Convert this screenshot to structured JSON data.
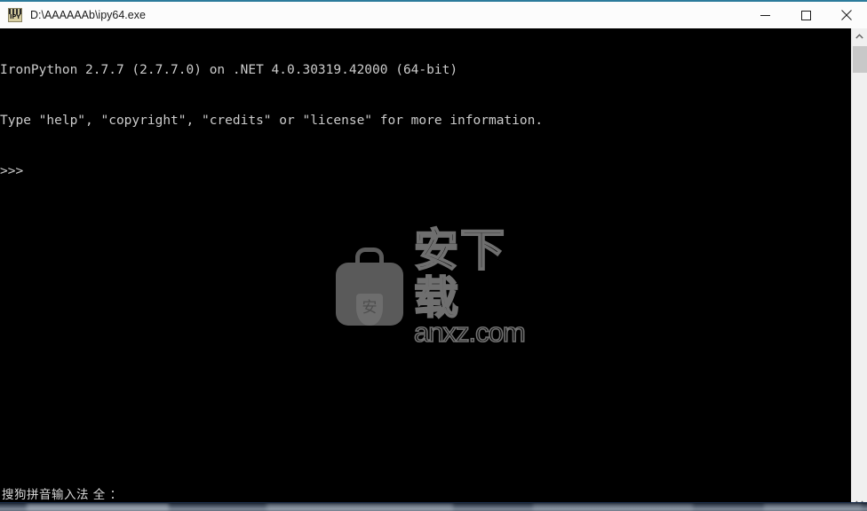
{
  "window": {
    "title": "D:\\AAAAAAb\\ipy64.exe",
    "icon_label": "IPY",
    "icon_name": "ironpython-console-icon",
    "accent_color": "#2c7b9c",
    "titlebar_bg": "#fcfcfc",
    "controls": {
      "minimize_label": "Minimize",
      "maximize_label": "Maximize",
      "close_label": "Close"
    }
  },
  "console": {
    "background_color": "#000000",
    "text_color": "#cccccc",
    "lines": [
      "IronPython 2.7.7 (2.7.7.0) on .NET 4.0.30319.42000 (64-bit)",
      "Type \"help\", \"copyright\", \"credits\" or \"license\" for more information.",
      ">>>"
    ],
    "prompt": ">>>"
  },
  "watermark": {
    "logo_glyph": "安",
    "brand_cn": "安下载",
    "domain": "anxz.com",
    "color": "#6f6f6f"
  },
  "ime": {
    "status_text": "搜狗拼音输入法 全 ："
  },
  "scrollbar": {
    "up_arrow": "▲",
    "down_arrow": "▼",
    "track_color": "#f0f0f0",
    "thumb_color": "#c8c8c8"
  }
}
